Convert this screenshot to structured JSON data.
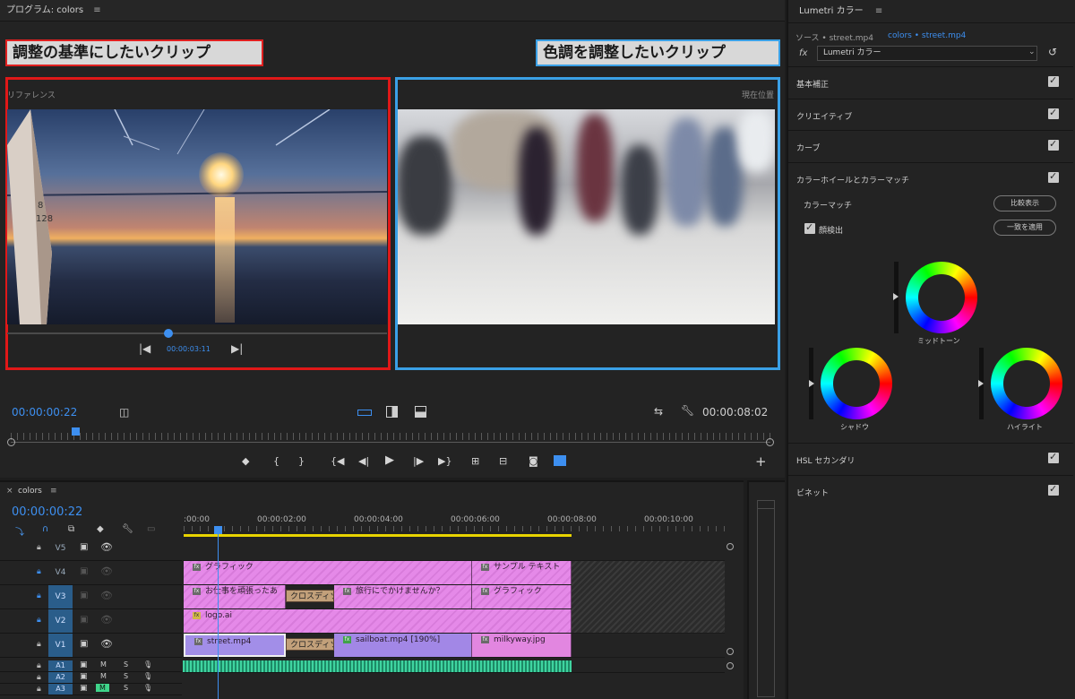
{
  "program": {
    "title": "プログラム: colors",
    "menu_icon": "≡",
    "callout_left": "調整の基準にしたいクリップ",
    "callout_right": "色調を調整したいクリップ",
    "label_reference": "リファレンス",
    "label_current": "現在位置",
    "reference_timecode": "00:00:03:11",
    "timecode": "00:00:00:22",
    "duration": "00:00:08:02"
  },
  "lumetri": {
    "title": "Lumetri カラー",
    "menu_icon": "≡",
    "source": "ソース • street.mp4",
    "clip": "colors • street.mp4",
    "fx": "fx",
    "effect": "Lumetri カラー",
    "sections": {
      "basic": "基本補正",
      "creative": "クリエイティブ",
      "curves": "カーブ",
      "wheels": "カラーホイールとカラーマッチ",
      "hsl": "HSL セカンダリ",
      "vignette": "ビネット"
    },
    "color_match": "カラーマッチ",
    "compare_view": "比較表示",
    "face_detect": "顔検出",
    "apply_match": "一致を適用",
    "midtones": "ミッドトーン",
    "shadows": "シャドウ",
    "highlights": "ハイライト"
  },
  "timeline": {
    "close": "×",
    "title": "colors",
    "menu_icon": "≡",
    "timecode": "00:00:00:22",
    "ruler": [
      ":00:00",
      "00:00:02:00",
      "00:00:04:00",
      "00:00:06:00",
      "00:00:08:00",
      "00:00:10:00"
    ],
    "tracks": {
      "v5": "V5",
      "v4": "V4",
      "v3": "V3",
      "v2": "V2",
      "v1": "V1",
      "a1": "A1",
      "a2": "A2",
      "a3": "A3"
    },
    "audio_m": "M",
    "audio_s": "S",
    "clips": {
      "v4_graphic": "グラフィック",
      "v4_sample": "サンプル テキスト",
      "v3_1": "お仕事を頑張ったあ",
      "v3_cross": "クロスディソ",
      "v3_travel": "旅行にでかけませんか？",
      "v3_graphic": "グラフィック",
      "v2_logo": "logo.ai",
      "v1_street": "street.mp4",
      "v1_cross": "クロスディソ",
      "v1_sailboat": "sailboat.mp4 [190%]",
      "v1_milkyway": "milkyway.jpg"
    }
  },
  "colors": {
    "accent_blue": "#3d8ff0",
    "callout_red": "#e01818",
    "callout_blue": "#3aa0e6",
    "clip_pink": "#e589e8",
    "clip_violet": "#a28ee8",
    "audio_green": "#3fd4a0",
    "work_area": "#e8d300"
  }
}
